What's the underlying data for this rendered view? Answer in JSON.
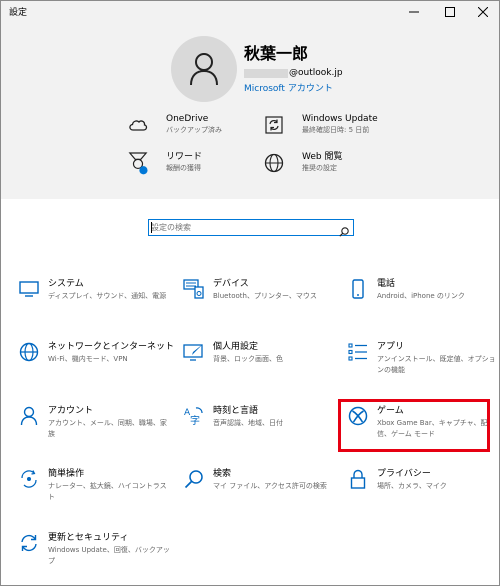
{
  "window": {
    "title": "設定",
    "minimize_icon": "minimize-icon",
    "maximize_icon": "maximize-icon",
    "close_icon": "close-icon"
  },
  "account": {
    "avatar_icon": "person-icon",
    "name": "秋葉一郎",
    "email_domain": "@outlook.jp",
    "microsoft_account_label": "Microsoft アカウント"
  },
  "quick_links": [
    {
      "title": "OneDrive",
      "subtitle": "バックアップ済み",
      "icon": "cloud-icon"
    },
    {
      "title": "Windows Update",
      "subtitle": "最終確認日時: 5 日前",
      "icon": "sync-icon"
    },
    {
      "title": "リワード",
      "subtitle": "報酬の獲得",
      "icon": "rewards-icon"
    },
    {
      "title": "Web 閲覧",
      "subtitle": "推奨の設定",
      "icon": "globe-icon"
    }
  ],
  "search": {
    "placeholder": "設定の検索",
    "icon": "search-icon"
  },
  "tiles": [
    {
      "title": "システム",
      "subtitle": "ディスプレイ、サウンド、通知、電源",
      "icon": "monitor-icon"
    },
    {
      "title": "デバイス",
      "subtitle": "Bluetooth、プリンター、マウス",
      "icon": "keyboard-speaker-icon"
    },
    {
      "title": "電話",
      "subtitle": "Android、iPhone のリンク",
      "icon": "phone-icon"
    },
    {
      "title": "ネットワークとインターネット",
      "subtitle": "Wi-Fi、機内モード、VPN",
      "icon": "globe-icon"
    },
    {
      "title": "個人用設定",
      "subtitle": "背景、ロック画面、色",
      "icon": "paint-monitor-icon"
    },
    {
      "title": "アプリ",
      "subtitle": "アンインストール、既定値、オプションの機能",
      "icon": "apps-list-icon"
    },
    {
      "title": "アカウント",
      "subtitle": "アカウント、メール、同期、職場、家族",
      "icon": "person-icon"
    },
    {
      "title": "時刻と言語",
      "subtitle": "音声認識、地域、日付",
      "icon": "time-language-icon"
    },
    {
      "title": "ゲーム",
      "subtitle": "Xbox Game Bar、キャプチャ、配信、ゲーム モード",
      "icon": "xbox-icon"
    },
    {
      "title": "簡単操作",
      "subtitle": "ナレーター、拡大鏡、ハイコントラスト",
      "icon": "ease-of-access-icon"
    },
    {
      "title": "検索",
      "subtitle": "マイ ファイル、アクセス許可の検索",
      "icon": "search-icon"
    },
    {
      "title": "プライバシー",
      "subtitle": "場所、カメラ、マイク",
      "icon": "lock-icon"
    },
    {
      "title": "更新とセキュリティ",
      "subtitle": "Windows Update、回復、バックアップ",
      "icon": "sync-icon"
    }
  ],
  "colors": {
    "accent": "#0067c0",
    "highlight_border": "#e60012",
    "header_bg": "#f2f2f2",
    "badge_blue": "#0078d7"
  }
}
